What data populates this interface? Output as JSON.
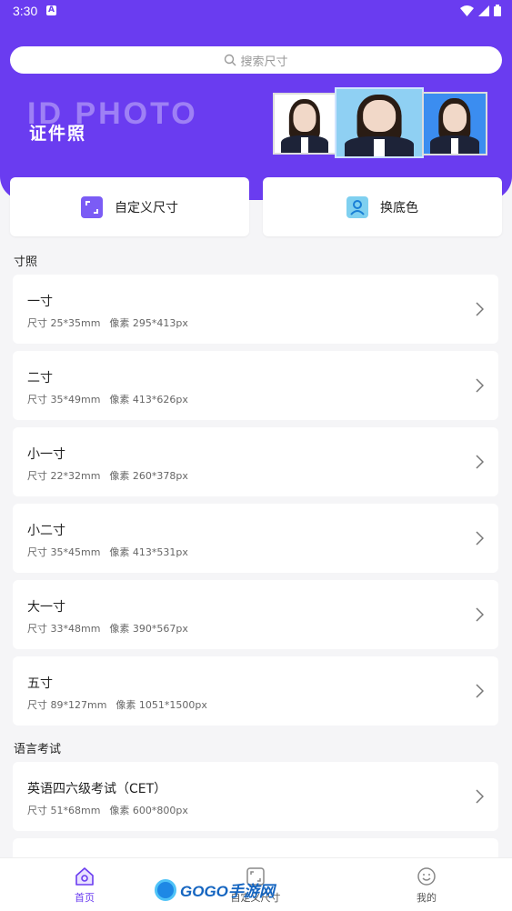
{
  "status_bar": {
    "time": "3:30",
    "notif_badge": "A"
  },
  "search": {
    "placeholder": "搜索尺寸"
  },
  "banner": {
    "title_en": "ID PHOTO",
    "title_cn": "证件照"
  },
  "quick_actions": [
    {
      "label": "自定义尺寸",
      "icon": "crop-frame-icon"
    },
    {
      "label": "换底色",
      "icon": "portrait-icon"
    }
  ],
  "sections": {
    "size_photos": "寸照",
    "language_exams": "语言考试"
  },
  "size_items": [
    {
      "name": "一寸",
      "size": "尺寸 25*35mm",
      "pixels": "像素 295*413px"
    },
    {
      "name": "二寸",
      "size": "尺寸 35*49mm",
      "pixels": "像素 413*626px"
    },
    {
      "name": "小一寸",
      "size": "尺寸 22*32mm",
      "pixels": "像素 260*378px"
    },
    {
      "name": "小二寸",
      "size": "尺寸 35*45mm",
      "pixels": "像素 413*531px"
    },
    {
      "name": "大一寸",
      "size": "尺寸 33*48mm",
      "pixels": "像素 390*567px"
    },
    {
      "name": "五寸",
      "size": "尺寸 89*127mm",
      "pixels": "像素 1051*1500px"
    }
  ],
  "exam_items": [
    {
      "name": "英语四六级考试（CET）",
      "size": "尺寸 51*68mm",
      "pixels": "像素 600*800px"
    }
  ],
  "tabs": [
    {
      "label": "首页",
      "active": true
    },
    {
      "label": "自定义尺寸",
      "active": false
    },
    {
      "label": "我的",
      "active": false
    }
  ],
  "watermark": {
    "text": "GOGO手游网"
  },
  "colors": {
    "primary": "#6a3cf0",
    "background": "#f5f5f7",
    "card": "#ffffff"
  }
}
